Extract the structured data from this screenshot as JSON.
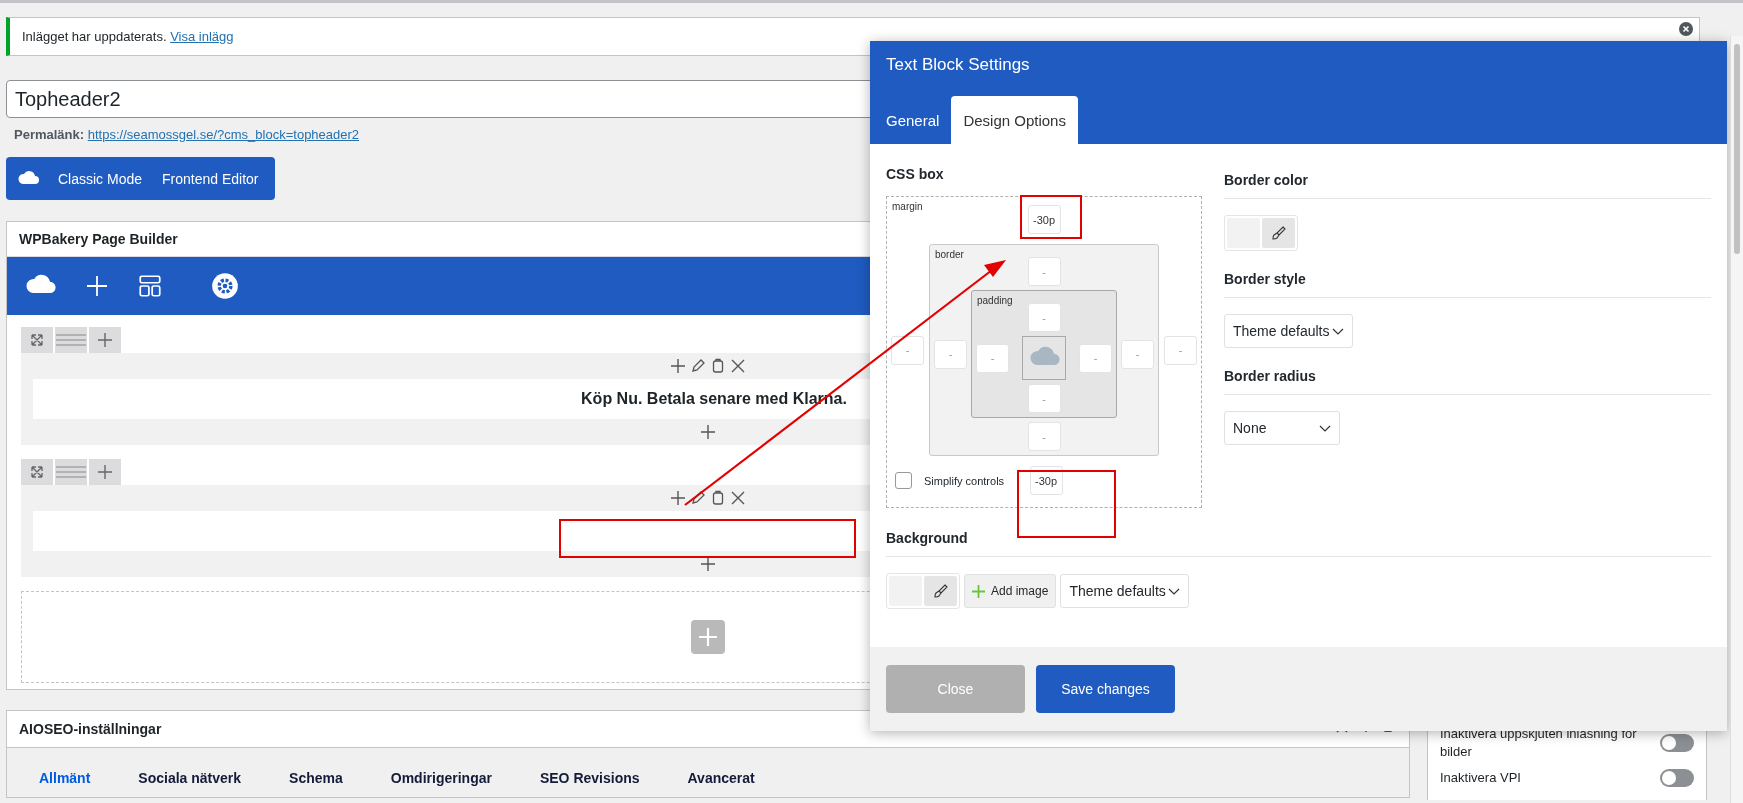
{
  "notice": {
    "text": "Inlägget har uppdaterats.",
    "link": "Visa inlägg"
  },
  "post_title": {
    "value": "Topheader2"
  },
  "permalink": {
    "label": "Permalänk:",
    "url": "https://seamossgel.se/?cms_block=topheader2"
  },
  "editor_buttons": [
    "Classic Mode",
    "Frontend Editor"
  ],
  "page_builder": {
    "title": "WPBakery Page Builder",
    "rows": [
      {
        "kind": "text",
        "text": "Köp Nu. Betala senare med Klarna."
      },
      {
        "kind": "empty"
      }
    ]
  },
  "seo": {
    "title": "AIOSEO-inställningar",
    "tabs": [
      {
        "label": "Allmänt",
        "selected": true
      },
      {
        "label": "Sociala nätverk",
        "selected": false
      },
      {
        "label": "Schema",
        "selected": false
      },
      {
        "label": "Omdirigeringar",
        "selected": false
      },
      {
        "label": "SEO Revisions",
        "selected": false
      },
      {
        "label": "Avancerat",
        "selected": false
      }
    ]
  },
  "sidebar": {
    "settings": [
      {
        "label": "Inaktivera uppskjuten inläsning för bilder",
        "on": false
      },
      {
        "label": "Inaktivera VPI",
        "on": false
      }
    ]
  },
  "modal": {
    "title": "Text Block Settings",
    "tabs": [
      {
        "label": "General",
        "selected": false
      },
      {
        "label": "Design Options",
        "selected": true
      }
    ],
    "css_box": {
      "title": "CSS box",
      "margin_label": "margin",
      "border_label": "border",
      "padding_label": "padding",
      "margin": {
        "top": {
          "value": "-30p"
        },
        "right": {
          "placeholder": "-"
        },
        "bottom": {
          "value": "-30p"
        },
        "left": {
          "placeholder": "-"
        }
      },
      "border": {
        "top": {
          "placeholder": "-"
        },
        "right": {
          "placeholder": "-"
        },
        "bottom": {
          "placeholder": "-"
        },
        "left": {
          "placeholder": "-"
        }
      },
      "padding": {
        "top": {
          "placeholder": "-"
        },
        "right": {
          "placeholder": "-"
        },
        "bottom": {
          "placeholder": "-"
        },
        "left": {
          "placeholder": "-"
        }
      },
      "simplify": {
        "label": "Simplify controls",
        "checked": false
      }
    },
    "border_color": {
      "title": "Border color"
    },
    "border_style": {
      "title": "Border style",
      "value": "Theme defaults"
    },
    "border_radius": {
      "title": "Border radius",
      "value": "None"
    },
    "background": {
      "title": "Background",
      "add_image": "Add image",
      "style": "Theme defaults"
    },
    "buttons": [
      {
        "label": "Close",
        "kind": "secondary"
      },
      {
        "label": "Save changes",
        "kind": "primary"
      }
    ]
  }
}
